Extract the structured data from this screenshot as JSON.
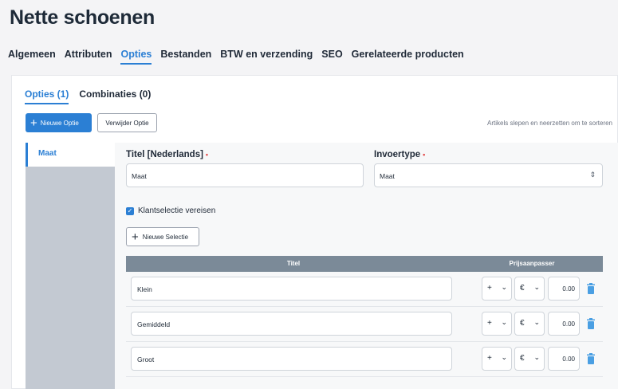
{
  "page": {
    "title": "Nette schoenen"
  },
  "main_tabs": [
    {
      "label": "Algemeen",
      "active": false
    },
    {
      "label": "Attributen",
      "active": false
    },
    {
      "label": "Opties",
      "active": true
    },
    {
      "label": "Bestanden",
      "active": false
    },
    {
      "label": "BTW en verzending",
      "active": false
    },
    {
      "label": "SEO",
      "active": false
    },
    {
      "label": "Gerelateerde producten",
      "active": false
    }
  ],
  "sub_tabs": [
    {
      "label": "Opties (1)",
      "active": true
    },
    {
      "label": "Combinaties (0)",
      "active": false
    }
  ],
  "toolbar": {
    "new_option_label": "Nieuwe Optie",
    "delete_option_label": "Verwijder Optie",
    "drag_hint": "Artikels slepen en neerzetten om te sorteren"
  },
  "options_list": [
    {
      "label": "Maat"
    }
  ],
  "form": {
    "title_label": "Titel [Nederlands]",
    "title_value": "Maat",
    "input_type_label": "Invoertype",
    "input_type_value": "Maat",
    "required_marker": "•",
    "checkbox_label": "Klantselectie vereisen",
    "checkbox_checked": true,
    "new_selection_label": "Nieuwe Selectie"
  },
  "selections_table": {
    "headers": {
      "title": "Titel",
      "price_adjuster": "Prijsaanpasser"
    },
    "rows": [
      {
        "title": "Klein",
        "sign": "+",
        "currency": "€",
        "price": "0.00"
      },
      {
        "title": "Gemiddeld",
        "sign": "+",
        "currency": "€",
        "price": "0.00"
      },
      {
        "title": "Groot",
        "sign": "+",
        "currency": "€",
        "price": "0.00"
      }
    ]
  },
  "colors": {
    "accent": "#2b7fd4",
    "table_header": "#7b8a98",
    "sidebar": "#c3c9d2",
    "trash_icon": "#4a9fe3"
  }
}
